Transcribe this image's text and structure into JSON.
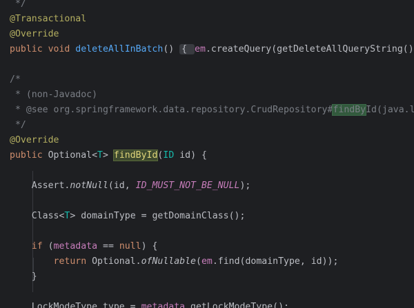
{
  "editor": {
    "lines": [
      {
        "tokens": [
          {
            "t": " */",
            "c": "cm"
          }
        ]
      },
      {
        "tokens": [
          {
            "t": "@Transactional",
            "c": "ann"
          }
        ]
      },
      {
        "tokens": [
          {
            "t": "@Override",
            "c": "ann"
          }
        ]
      },
      {
        "tokens": [
          {
            "t": "public ",
            "c": "kw"
          },
          {
            "t": "void ",
            "c": "kw"
          },
          {
            "t": "deleteAllInBatch",
            "c": "fn"
          },
          {
            "t": "() ",
            "c": "pl"
          },
          {
            "t": "{ ",
            "c": "fold"
          },
          {
            "t": "em",
            "c": "fld"
          },
          {
            "t": ".createQuery(getDeleteAllQueryString()).",
            "c": "pl"
          }
        ]
      },
      {
        "tokens": []
      },
      {
        "tokens": [
          {
            "t": "/*",
            "c": "cm"
          }
        ]
      },
      {
        "tokens": [
          {
            "t": " * (non-Javadoc)",
            "c": "cm"
          }
        ]
      },
      {
        "tokens": [
          {
            "t": " * @see org.springframework.data.repository.CrudRepository#",
            "c": "cm"
          },
          {
            "t": "findBy",
            "c": "cm hl-used"
          },
          {
            "t": "Id(java.lang.Object)",
            "c": "cm"
          }
        ]
      },
      {
        "tokens": [
          {
            "t": " */",
            "c": "cm"
          }
        ]
      },
      {
        "tokens": [
          {
            "t": "@Override",
            "c": "ann"
          }
        ]
      },
      {
        "tokens": [
          {
            "t": "public ",
            "c": "kw"
          },
          {
            "t": "Optional<",
            "c": "pl"
          },
          {
            "t": "T",
            "c": "tp"
          },
          {
            "t": "> ",
            "c": "pl"
          },
          {
            "t": "findById",
            "c": "hl-def"
          },
          {
            "t": "(",
            "c": "pl"
          },
          {
            "t": "ID",
            "c": "tp"
          },
          {
            "t": " id) {",
            "c": "pl"
          }
        ]
      },
      {
        "tokens": []
      },
      {
        "tokens": [
          {
            "t": "    Assert.",
            "c": "pl"
          },
          {
            "t": "notNull",
            "c": "st"
          },
          {
            "t": "(id, ",
            "c": "pl"
          },
          {
            "t": "ID_MUST_NOT_BE_NULL",
            "c": "cst"
          },
          {
            "t": ");",
            "c": "pl"
          }
        ]
      },
      {
        "tokens": []
      },
      {
        "tokens": [
          {
            "t": "    Class<",
            "c": "pl"
          },
          {
            "t": "T",
            "c": "tp"
          },
          {
            "t": "> domainType = getDomainClass();",
            "c": "pl"
          }
        ]
      },
      {
        "tokens": []
      },
      {
        "tokens": [
          {
            "t": "    ",
            "c": "pl"
          },
          {
            "t": "if ",
            "c": "kw"
          },
          {
            "t": "(",
            "c": "pl"
          },
          {
            "t": "metadata",
            "c": "fld"
          },
          {
            "t": " == ",
            "c": "pl"
          },
          {
            "t": "null",
            "c": "kw"
          },
          {
            "t": ") {",
            "c": "pl"
          }
        ]
      },
      {
        "tokens": [
          {
            "t": "        ",
            "c": "pl"
          },
          {
            "t": "return ",
            "c": "kw"
          },
          {
            "t": "Optional.",
            "c": "pl"
          },
          {
            "t": "ofNullable",
            "c": "st"
          },
          {
            "t": "(",
            "c": "pl"
          },
          {
            "t": "em",
            "c": "fld"
          },
          {
            "t": ".find(domainType, id));",
            "c": "pl"
          }
        ]
      },
      {
        "tokens": [
          {
            "t": "    }",
            "c": "pl"
          }
        ]
      },
      {
        "tokens": []
      },
      {
        "tokens": [
          {
            "t": "    LockModeType type = ",
            "c": "pl"
          },
          {
            "t": "metadata",
            "c": "fld"
          },
          {
            "t": ".getLockModeType();",
            "c": "pl"
          }
        ]
      }
    ]
  }
}
